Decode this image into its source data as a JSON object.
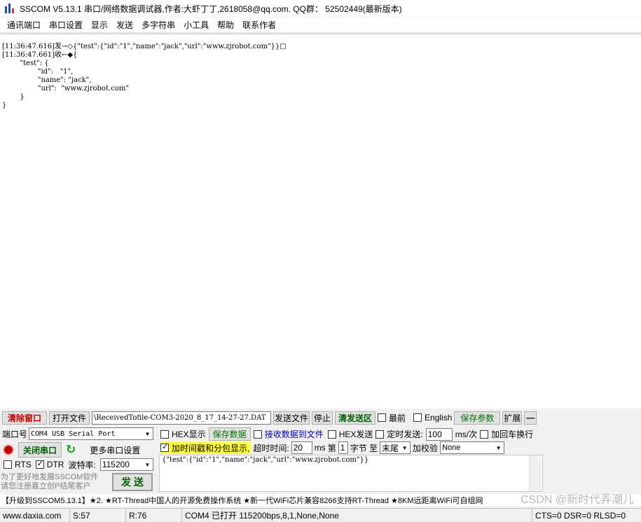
{
  "title": "SSCOM V5.13.1 串口/网络数据调试器,作者:大虾丁丁,2618058@qq.com. QQ群： 52502449(最新版本)",
  "menu": [
    "通讯端口",
    "串口设置",
    "显示",
    "发送",
    "多字符串",
    "小工具",
    "帮助",
    "联系作者"
  ],
  "receive_log": [
    "[11:36:47.616]发→◇{\"test\":{\"id\":\"1\",\"name\":\"jack\",\"url\":\"www.zjrobot.com\"}}□",
    "[11:36:47.661]收←◆{",
    "        \"test\": {",
    "                \"id\":   \"1\",",
    "                \"name\": \"jack\",",
    "                \"url\":  \"www.zjrobot.com\"",
    "        }",
    "}"
  ],
  "toolbar1": {
    "clear_window": "清除窗口",
    "open_file": "打开文件",
    "file_path": "\\ReceivedTofile-COM3-2020_8_17_14-27-27.DAT",
    "send_file": "发送文件",
    "stop": "停止",
    "clear_send": "清发送区",
    "topmost": "最前",
    "english": "English",
    "save_params": "保存参数",
    "expand": "扩展",
    "collapse": "—"
  },
  "port": {
    "label": "端口号",
    "value": "COM4 USB Serial Port",
    "close_port": "关闭串口",
    "more_settings": "更多串口设置",
    "rts": "RTS",
    "dtr": "DTR",
    "baud_label": "波特率:",
    "baud": "115200",
    "promo": "为了更好地发展SSCOM软件\n请您注册嘉立创P结尾客户",
    "send": "发 送"
  },
  "options": {
    "hex_display": "HEX显示",
    "save_data": "保存数据",
    "recv_to_file": "接收数据到文件",
    "hex_send": "HEX发送",
    "timed_send": "定时发送:",
    "interval": "100",
    "interval_unit": "ms/次",
    "add_crlf": "加回车换行",
    "timestamp": "加时间戳和分包显示,",
    "timeout_label": "超时时间:",
    "timeout": "20",
    "timeout_unit": "ms",
    "byte_label_pre": "第",
    "byte_index": "1",
    "byte_label_post": "字节 至",
    "byte_end": "末尾",
    "checksum_label": "加校验",
    "checksum": "None"
  },
  "send_text": "{\"test\":{\"id\":\"1\",\"name\":\"jack\",\"url\":\"www.zjrobot.com\"}}",
  "news": "【升级到SSCOM5.13.1】★2. ★RT-Thread中国人的开源免费操作系统 ★新一代WiFi芯片兼容8266支持RT-Thread ★8KM远距离WiFi可自组网",
  "watermark": "CSDN @新时代弄潮儿",
  "status": {
    "site": "www.daxia.com",
    "sent": "S:57",
    "recv": "R:76",
    "port_state": "COM4 已打开  115200bps,8,1,None,None",
    "lines": "CTS=0 DSR=0 RLSD=0"
  }
}
